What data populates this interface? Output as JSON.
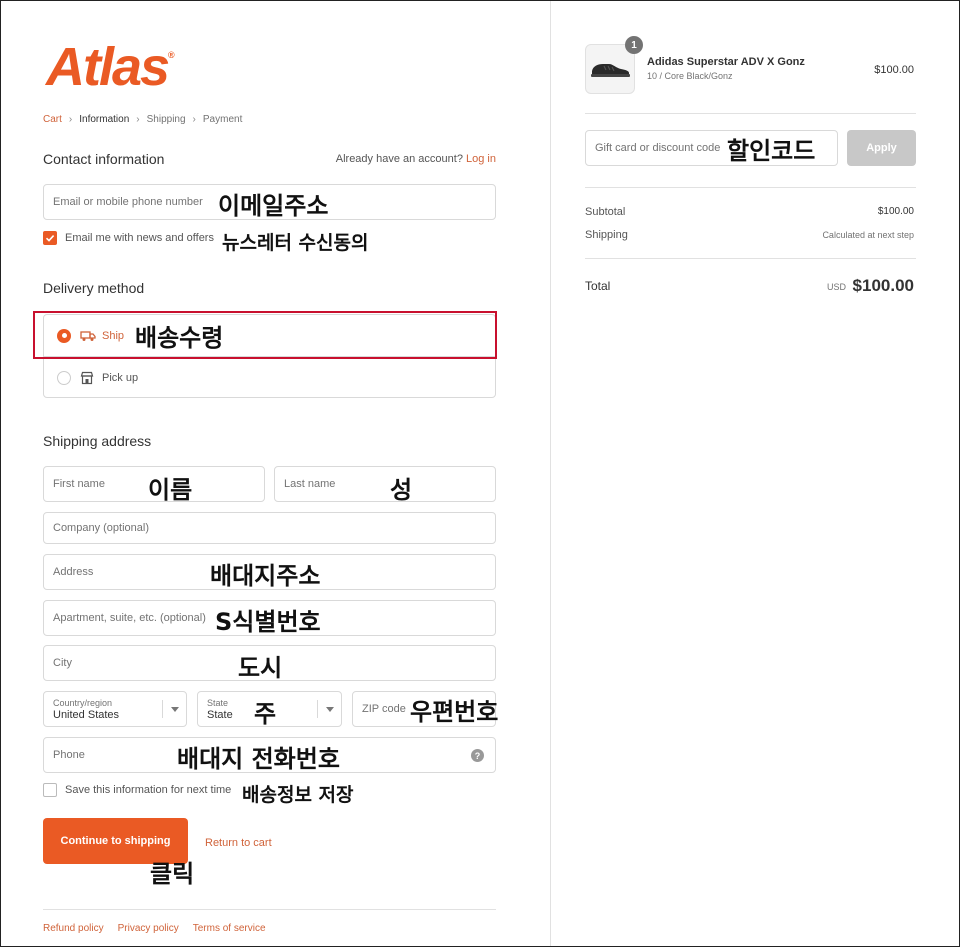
{
  "brand": {
    "logo_text": "Atlas",
    "trademark": "®"
  },
  "breadcrumb": [
    "Cart",
    "Information",
    "Shipping",
    "Payment"
  ],
  "contact": {
    "title": "Contact information",
    "account_prompt": "Already have an account?",
    "login_label": "Log in",
    "email_placeholder": "Email or mobile phone number",
    "email_annotation": "이메일주소",
    "newsletter_label": "Email me with news and offers",
    "newsletter_annotation": "뉴스레터 수신동의",
    "newsletter_checked": true
  },
  "delivery": {
    "title": "Delivery method",
    "ship_label": "Ship",
    "ship_annotation": "배송수령",
    "pickup_label": "Pick up",
    "selected": "ship"
  },
  "shipping": {
    "title": "Shipping address",
    "first_name": {
      "placeholder": "First name",
      "annotation": "이름"
    },
    "last_name": {
      "placeholder": "Last name",
      "annotation": "성"
    },
    "company": {
      "placeholder": "Company (optional)"
    },
    "address": {
      "placeholder": "Address",
      "annotation": "배대지주소"
    },
    "apartment": {
      "placeholder": "Apartment, suite, etc. (optional)",
      "annotation": "S식별번호"
    },
    "city": {
      "placeholder": "City",
      "annotation": "도시"
    },
    "country": {
      "label": "Country/region",
      "value": "United States"
    },
    "state": {
      "label": "State",
      "value": "State",
      "annotation": "주"
    },
    "zip": {
      "placeholder": "ZIP code",
      "annotation": "우편번호"
    },
    "phone": {
      "placeholder": "Phone",
      "annotation": "배대지 전화번호"
    },
    "save_label": "Save this information for next time",
    "save_annotation": "배송정보 저장",
    "save_checked": false
  },
  "actions": {
    "continue_label": "Continue to shipping",
    "continue_annotation": "클릭",
    "return_label": "Return to cart"
  },
  "footer": [
    "Refund policy",
    "Privacy policy",
    "Terms of service"
  ],
  "order": {
    "quantity": "1",
    "product_name": "Adidas Superstar ADV X Gonz",
    "variant": "10 / Core Black/Gonz",
    "price": "$100.00",
    "discount_placeholder": "Gift card or discount code",
    "discount_annotation": "할인코드",
    "apply_label": "Apply",
    "subtotal_label": "Subtotal",
    "subtotal_value": "$100.00",
    "shipping_label": "Shipping",
    "shipping_value": "Calculated at next step",
    "total_label": "Total",
    "currency": "USD",
    "total_value": "$100.00"
  },
  "colors": {
    "accent": "#ea5a24",
    "highlight": "#c8102e",
    "apply_disabled": "#c8c8c8"
  }
}
